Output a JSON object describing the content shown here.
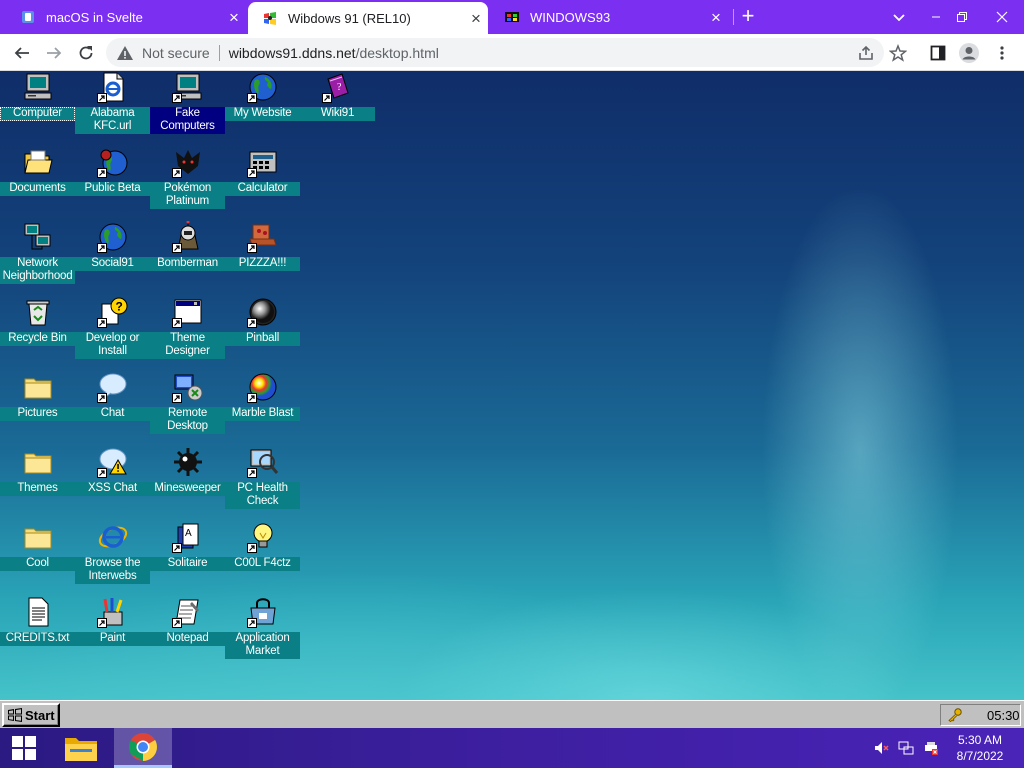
{
  "browser": {
    "tabs": [
      {
        "title": "macOS in Svelte",
        "favicon": "svelte-mac-icon",
        "active": false
      },
      {
        "title": "Wibdows 91 (REL10)",
        "favicon": "wibdows-icon",
        "active": true
      },
      {
        "title": "WINDOWS93",
        "favicon": "windows93-icon",
        "active": false
      }
    ],
    "omnibox": {
      "security_label": "Not secure",
      "url_host": "wibdows91.ddns.net",
      "url_path": "/desktop.html"
    },
    "colors": {
      "tabstrip": "#7b2ff0",
      "toolbar": "#ffffff"
    }
  },
  "desktop": {
    "icons": [
      {
        "label": "Computer",
        "icon": "computer-icon",
        "shortcut": false
      },
      {
        "label": "Alabama KFC.url",
        "icon": "ie-page-icon",
        "shortcut": true
      },
      {
        "label": "Fake Computers",
        "icon": "computer-icon",
        "shortcut": true
      },
      {
        "label": "My Website",
        "icon": "globe-icon",
        "shortcut": true
      },
      {
        "label": "Wiki91",
        "icon": "book-icon",
        "shortcut": true
      },
      {
        "label": "Documents",
        "icon": "open-folder-icon",
        "shortcut": false
      },
      {
        "label": "Public Beta",
        "icon": "globe-bug-icon",
        "shortcut": true
      },
      {
        "label": "Pokémon Platinum",
        "icon": "pokemon-icon",
        "shortcut": true
      },
      {
        "label": "Calculator",
        "icon": "calculator-icon",
        "shortcut": true
      },
      {
        "label": "Network Neighborhood",
        "icon": "network-icon",
        "shortcut": false
      },
      {
        "label": "Social91",
        "icon": "globe-icon",
        "shortcut": true
      },
      {
        "label": "Bomberman",
        "icon": "bomberman-icon",
        "shortcut": true
      },
      {
        "label": "PIZZZA!!!",
        "icon": "pizza-laptop-icon",
        "shortcut": true
      },
      {
        "label": "Recycle Bin",
        "icon": "recycle-bin-icon",
        "shortcut": false
      },
      {
        "label": "Develop or Install",
        "icon": "help-icon",
        "shortcut": true
      },
      {
        "label": "Theme Designer",
        "icon": "window-icon",
        "shortcut": true
      },
      {
        "label": "Pinball",
        "icon": "pinball-icon",
        "shortcut": true
      },
      {
        "label": "Pictures",
        "icon": "folder-icon",
        "shortcut": false
      },
      {
        "label": "Chat",
        "icon": "chat-bubble-icon",
        "shortcut": true
      },
      {
        "label": "Remote Desktop",
        "icon": "remote-desktop-icon",
        "shortcut": true
      },
      {
        "label": "Marble Blast",
        "icon": "marble-icon",
        "shortcut": true
      },
      {
        "label": "Themes",
        "icon": "folder-icon",
        "shortcut": false
      },
      {
        "label": "XSS Chat",
        "icon": "chat-warning-icon",
        "shortcut": true
      },
      {
        "label": "Minesweeper",
        "icon": "mine-icon",
        "shortcut": false
      },
      {
        "label": "PC Health Check",
        "icon": "pc-health-icon",
        "shortcut": true
      },
      {
        "label": "Cool",
        "icon": "folder-icon",
        "shortcut": false
      },
      {
        "label": "Browse the Interwebs",
        "icon": "ie-icon",
        "shortcut": false
      },
      {
        "label": "Solitaire",
        "icon": "cards-icon",
        "shortcut": true
      },
      {
        "label": "C00L F4ctz",
        "icon": "lightbulb-icon",
        "shortcut": true
      },
      {
        "label": "CREDITS.txt",
        "icon": "text-file-icon",
        "shortcut": false
      },
      {
        "label": "Paint",
        "icon": "paint-icon",
        "shortcut": true
      },
      {
        "label": "Notepad",
        "icon": "notepad-icon",
        "shortcut": true
      },
      {
        "label": "Application Market",
        "icon": "app-market-icon",
        "shortcut": true
      }
    ],
    "colors": {
      "label_bg": "#0a7f86",
      "label_selected_bg": "#000080",
      "label_text": "#ffffff"
    }
  },
  "w9taskbar": {
    "start_label": "Start",
    "clock": "05:30"
  },
  "hosttaskbar": {
    "time": "5:30 AM",
    "date": "8/7/2022",
    "apps": [
      "windows-start-icon",
      "file-explorer-icon",
      "chrome-icon"
    ]
  }
}
